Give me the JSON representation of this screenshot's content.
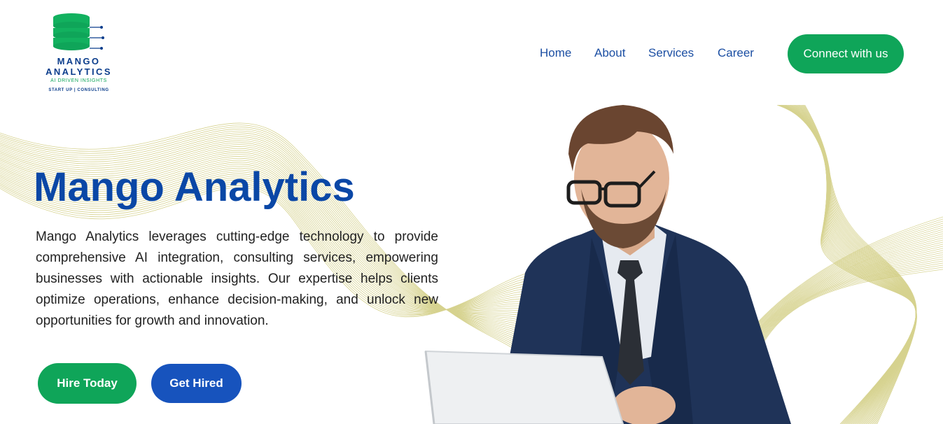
{
  "brand": {
    "name_line1": "MANGO",
    "name_line2": "ANALYTICS",
    "tagline": "AI DRIVEN INSIGHTS",
    "subline": "START UP | CONSULTING"
  },
  "nav": {
    "items": [
      {
        "label": "Home"
      },
      {
        "label": "About"
      },
      {
        "label": "Services"
      },
      {
        "label": "Career"
      }
    ],
    "cta_label": "Connect with us"
  },
  "hero": {
    "title": "Mango Analytics",
    "description": "Mango Analytics leverages cutting-edge technology to provide comprehensive AI integration,  consulting services, empowering businesses with actionable insights. Our expertise helps clients optimize operations, enhance decision-making, and unlock new opportunities for growth and innovation.",
    "primary_button": "Hire Today",
    "secondary_button": "Get Hired"
  },
  "colors": {
    "brand_blue": "#0a47a6",
    "nav_blue": "#1c4fa3",
    "green": "#0fa559",
    "button_blue": "#1753bd",
    "wave": "#c9c46a"
  }
}
